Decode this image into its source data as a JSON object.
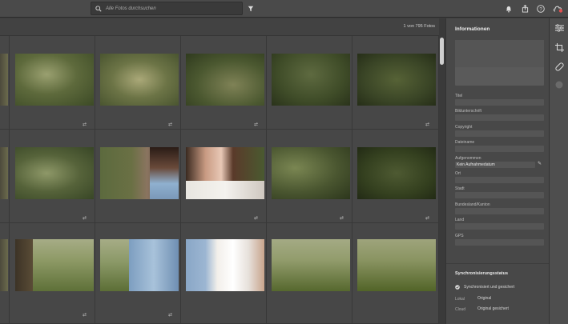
{
  "search": {
    "placeholder": "Alle Fotos durchsuchen"
  },
  "toolbar": {
    "icons": [
      "search-icon",
      "filter-icon",
      "bell-icon",
      "share-icon",
      "help-icon",
      "cloud-sync-icon"
    ]
  },
  "grid": {
    "count_label": "1 von 795 Fotos"
  },
  "panel": {
    "title": "Informationen",
    "fields": [
      {
        "label": "Titel",
        "value": ""
      },
      {
        "label": "Bildunterschrift",
        "value": ""
      },
      {
        "label": "Copyright",
        "value": ""
      },
      {
        "label": "Dateiname",
        "value": ""
      },
      {
        "label": "Aufgenommen",
        "value": "Kein Aufnahmedatum"
      },
      {
        "label": "Ort",
        "value": ""
      },
      {
        "label": "Stadt",
        "value": ""
      },
      {
        "label": "Bundesland/Kanton",
        "value": ""
      },
      {
        "label": "Land",
        "value": ""
      },
      {
        "label": "GPS",
        "value": ""
      }
    ],
    "sync": {
      "title": "Synchronisierungsstatus",
      "status": "Synchronisiert und gesichert",
      "local_label": "Lokal",
      "local_value": "Original",
      "cloud_label": "Cloud",
      "cloud_value": "Original gesichert"
    }
  },
  "rail": {
    "icons": [
      "sliders-icon",
      "crop-icon",
      "healing-bandage-icon",
      "circle-mask-icon"
    ]
  },
  "colors": {
    "accent_sync": "#e05050",
    "bg": "#424242"
  }
}
